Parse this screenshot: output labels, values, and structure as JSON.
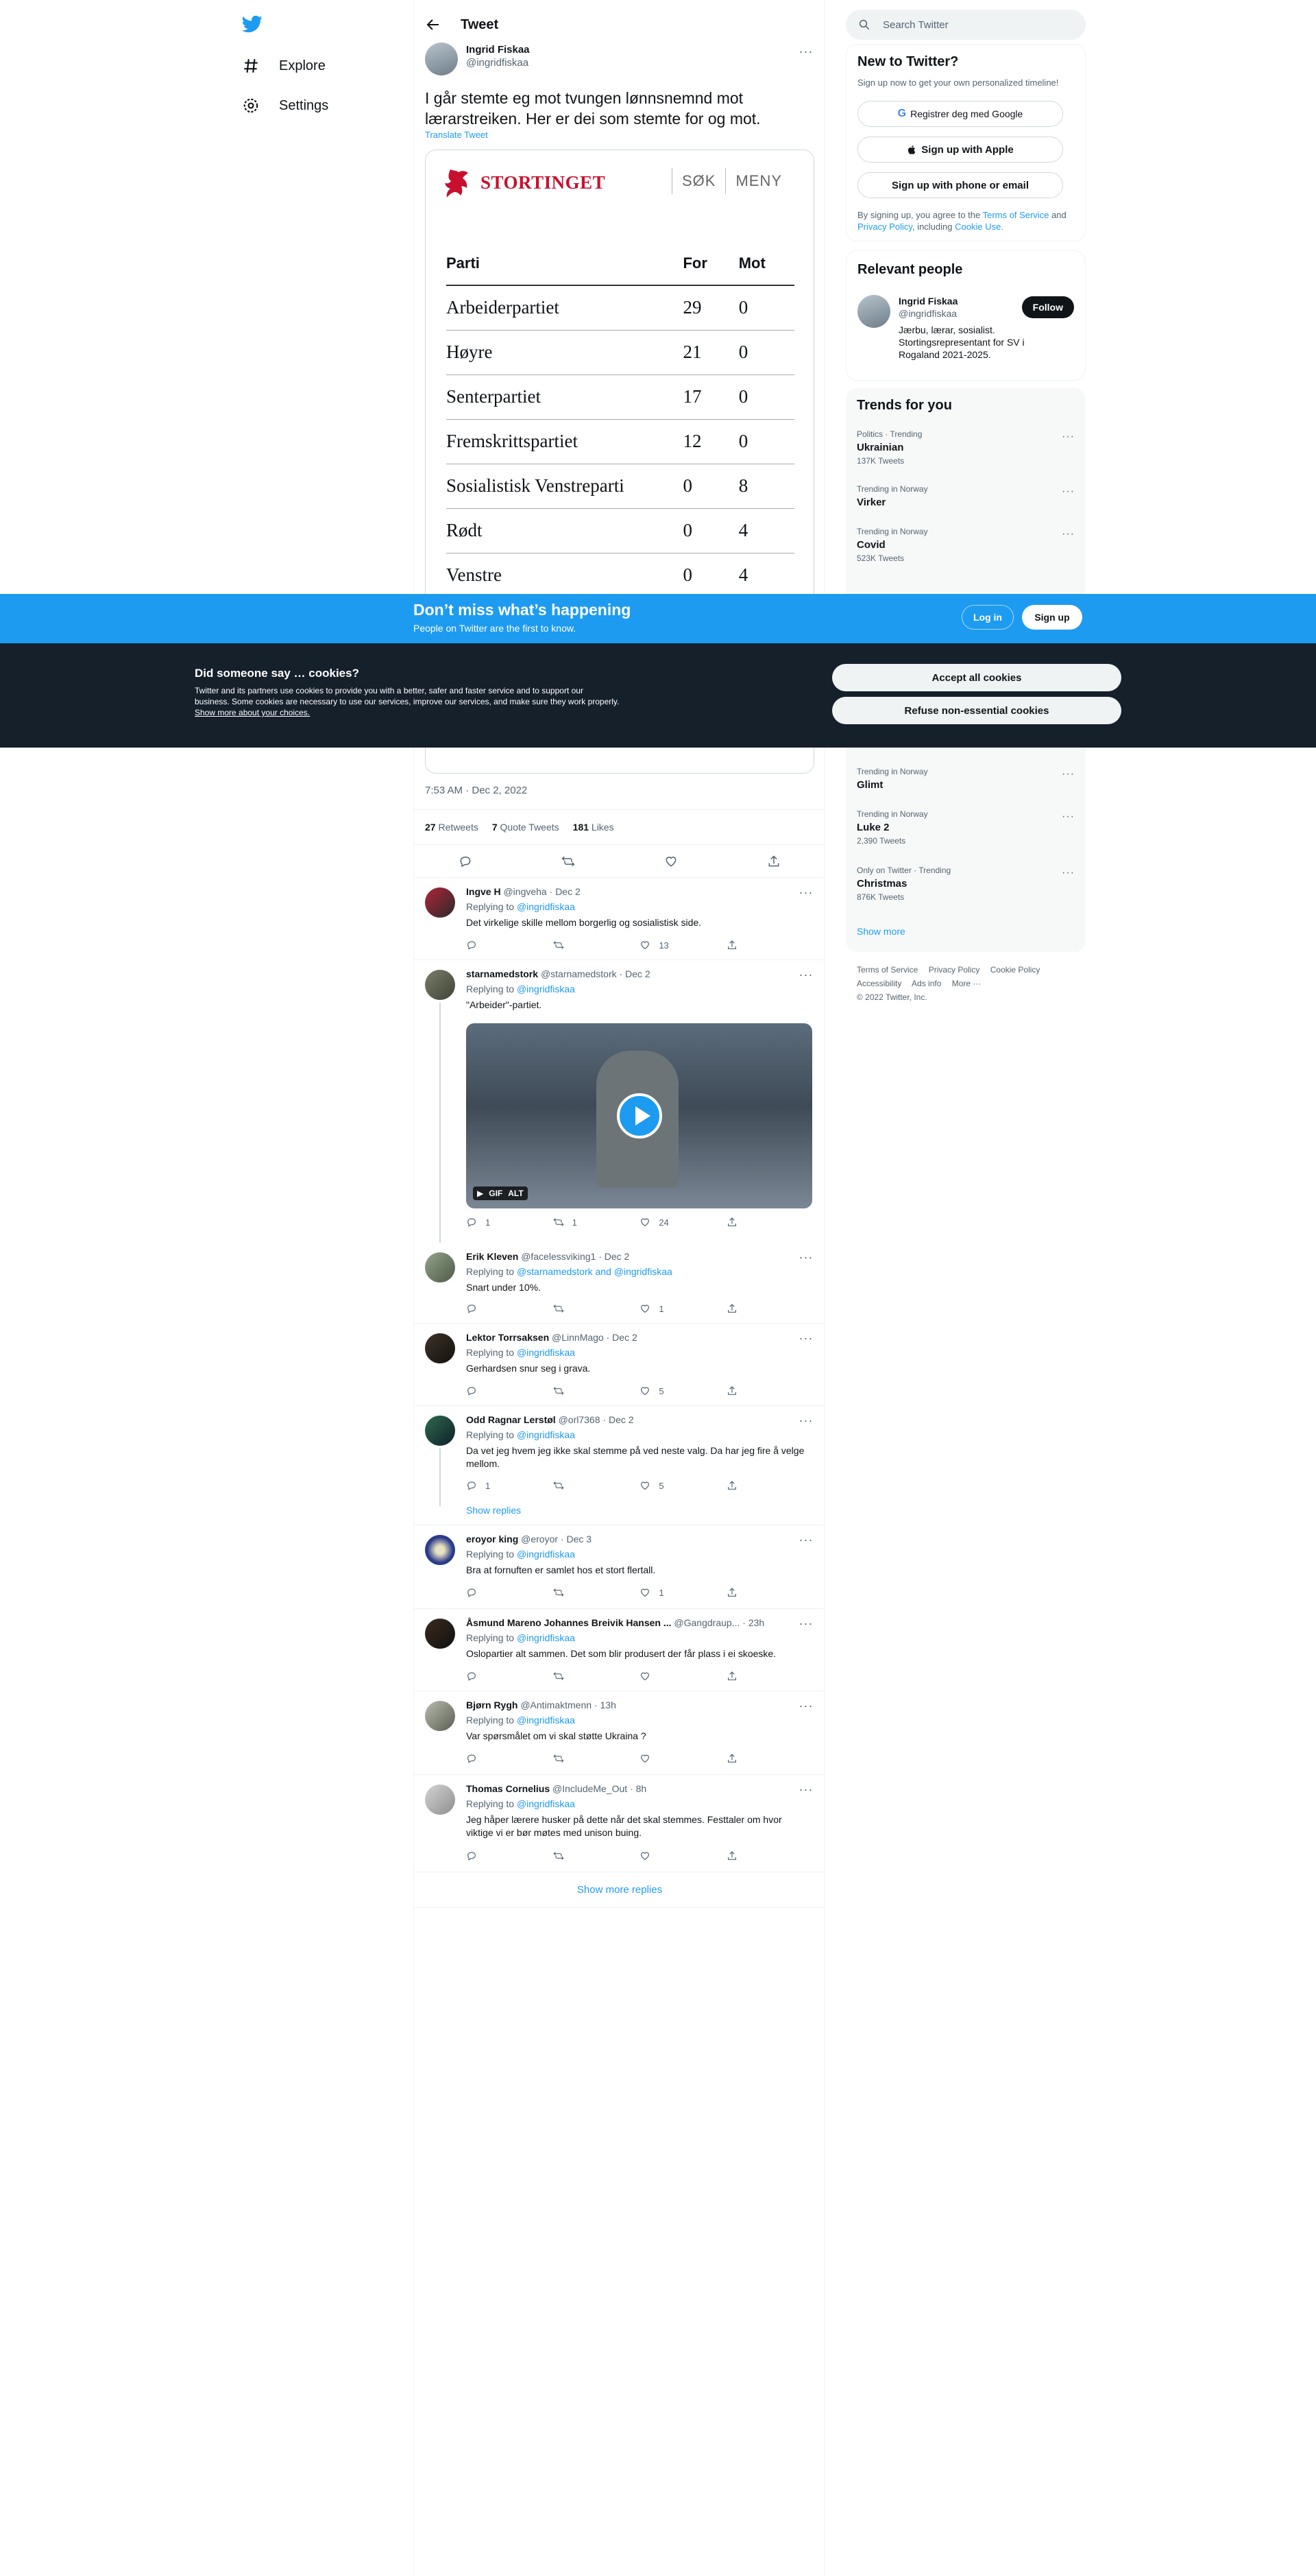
{
  "nav": {
    "explore": "Explore",
    "settings": "Settings"
  },
  "header": {
    "title": "Tweet"
  },
  "tweet": {
    "author_name": "Ingrid Fiskaa",
    "author_handle": "@ingridfiskaa",
    "text": "I går stemte eg mot tvungen lønnsnemnd mot lærarstreiken. Her er dei som stemte for og mot.",
    "translate": "Translate Tweet",
    "timestamp": "7:53 AM · Dec 2, 2022",
    "retweets_count": "27",
    "retweets_label": "Retweets",
    "quotes_count": "7",
    "quotes_label": "Quote Tweets",
    "likes_count": "181",
    "likes_label": "Likes"
  },
  "media": {
    "logo_text": "STORTINGET",
    "nav_search": "SØK",
    "nav_menu": "MENY",
    "table_headers": [
      "Parti",
      "For",
      "Mot"
    ],
    "rows": [
      [
        "Arbeiderpartiet",
        "29",
        "0"
      ],
      [
        "Høyre",
        "21",
        "0"
      ],
      [
        "Senterpartiet",
        "17",
        "0"
      ],
      [
        "Fremskrittspartiet",
        "12",
        "0"
      ],
      [
        "Sosialistisk Venstreparti",
        "0",
        "8"
      ],
      [
        "Rødt",
        "0",
        "4"
      ],
      [
        "Venstre",
        "0",
        "4"
      ]
    ]
  },
  "replies": [
    {
      "name": "Ingve H",
      "handle": "@ingveha",
      "date": "Dec 2",
      "replying_to": "Replying to",
      "mention": "@ingridfiskaa",
      "text": "Det virkelige skille mellom borgerlig og sosialistisk side.",
      "replies": "",
      "retweets": "",
      "likes": "13"
    },
    {
      "name": "starnamedstork",
      "handle": "@starnamedstork",
      "date": "Dec 2",
      "replying_to": "Replying to",
      "mention": "@ingridfiskaa",
      "text": "\"Arbeider\"-partiet.",
      "replies": "1",
      "retweets": "1",
      "likes": "24",
      "gif_badge": "GIF",
      "alt_badge": "ALT"
    },
    {
      "name": "Erik Kleven",
      "handle": "@facelessviking1",
      "date": "Dec 2",
      "replying_to": "Replying to",
      "mention": "@starnamedstork and @ingridfiskaa",
      "text": "Snart under 10%.",
      "replies": "",
      "retweets": "",
      "likes": "1"
    },
    {
      "name": "Lektor Torrsaksen",
      "handle": "@LinnMago",
      "date": "Dec 2",
      "replying_to": "Replying to",
      "mention": "@ingridfiskaa",
      "text": "Gerhardsen snur seg i grava.",
      "replies": "",
      "retweets": "",
      "likes": "5"
    },
    {
      "name": "Odd Ragnar Lerstøl",
      "handle": "@orl7368",
      "date": "Dec 2",
      "replying_to": "Replying to",
      "mention": "@ingridfiskaa",
      "text": "Da vet jeg hvem jeg ikke skal stemme på ved neste valg. Da har jeg fire å velge mellom.",
      "replies": "1",
      "retweets": "",
      "likes": "5",
      "show_replies": "Show replies"
    },
    {
      "name": "eroyor king",
      "handle": "@eroyor",
      "date": "Dec 3",
      "replying_to": "Replying to",
      "mention": "@ingridfiskaa",
      "text": "Bra at fornuften er samlet hos et stort flertall.",
      "replies": "",
      "retweets": "",
      "likes": "1"
    },
    {
      "name": "Åsmund Mareno Johannes Breivik Hansen ...",
      "handle": "@Gangdraup...",
      "date": "23h",
      "replying_to": "Replying to",
      "mention": "@ingridfiskaa",
      "text": "Oslopartier alt sammen. Det som blir produsert der får plass i ei skoeske.",
      "replies": "",
      "retweets": "",
      "likes": ""
    },
    {
      "name": "Bjørn Rygh",
      "handle": "@Antimaktmenn",
      "date": "13h",
      "replying_to": "Replying to",
      "mention": "@ingridfiskaa",
      "text": "Var spørsmålet om vi skal støtte Ukraina ?",
      "replies": "",
      "retweets": "",
      "likes": ""
    },
    {
      "name": "Thomas Cornelius",
      "handle": "@IncludeMe_Out",
      "date": "8h",
      "replying_to": "Replying to",
      "mention": "@ingridfiskaa",
      "text": "Jeg håper lærere husker på dette når det skal stemmes. Festtaler om hvor viktige vi er bør møtes med unison buing.",
      "replies": "",
      "retweets": "",
      "likes": ""
    }
  ],
  "show_more_replies": "Show more replies",
  "right": {
    "search_placeholder": "Search Twitter",
    "signup": {
      "title": "New to Twitter?",
      "subtitle": "Sign up now to get your own personalized timeline!",
      "google": "Registrer deg med Google",
      "apple": "Sign up with Apple",
      "phone": "Sign up with phone or email",
      "terms_1": "By signing up, you agree to the",
      "terms_link1": "Terms of Service",
      "terms_and": "and",
      "terms_link2": "Privacy Policy",
      "terms_including": ", including",
      "terms_link3": "Cookie Use."
    },
    "relevant": {
      "title": "Relevant people",
      "name": "Ingrid Fiskaa",
      "handle": "@ingridfiskaa",
      "bio": "Jærbu, lærar, sosialist. Stortingsrepresentant for SV i Rogaland 2021-2025.",
      "follow": "Follow"
    },
    "trends": {
      "title": "Trends for you",
      "items": [
        {
          "meta": "Politics · Trending",
          "title": "Ukrainian",
          "count": "137K Tweets"
        },
        {
          "meta": "Trending in Norway",
          "title": "Virker",
          "count": ""
        },
        {
          "meta": "Trending in Norway",
          "title": "Covid",
          "count": "523K Tweets"
        },
        {
          "meta": "Trending in Norway",
          "title": "Glimt",
          "count": ""
        },
        {
          "meta": "Trending in Norway",
          "title": "Luke 2",
          "count": "2,390 Tweets"
        },
        {
          "meta": "Only on Twitter · Trending",
          "title": "Christmas",
          "count": "876K Tweets"
        }
      ],
      "show_more": "Show more"
    },
    "footer": {
      "terms": "Terms of Service",
      "privacy": "Privacy Policy",
      "cookie": "Cookie Policy",
      "accessibility": "Accessibility",
      "ads": "Ads info",
      "more": "More ···",
      "copyright": "© 2022 Twitter, Inc."
    }
  },
  "bottom_bar": {
    "title": "Don’t miss what’s happening",
    "subtitle": "People on Twitter are the first to know.",
    "login": "Log in",
    "signup": "Sign up"
  },
  "cookie": {
    "title": "Did someone say … cookies?",
    "text": "Twitter and its partners use cookies to provide you with a better, safer and faster service and to support our business. Some cookies are necessary to use our services, improve our services, and make sure they work properly.",
    "link": "Show more about your choices.",
    "accept": "Accept all cookies",
    "refuse": "Refuse non-essential cookies"
  },
  "colors": {
    "accent": "#1d9bf0",
    "stortinget_red": "#c8102e",
    "cookie_bg": "#15202b"
  }
}
